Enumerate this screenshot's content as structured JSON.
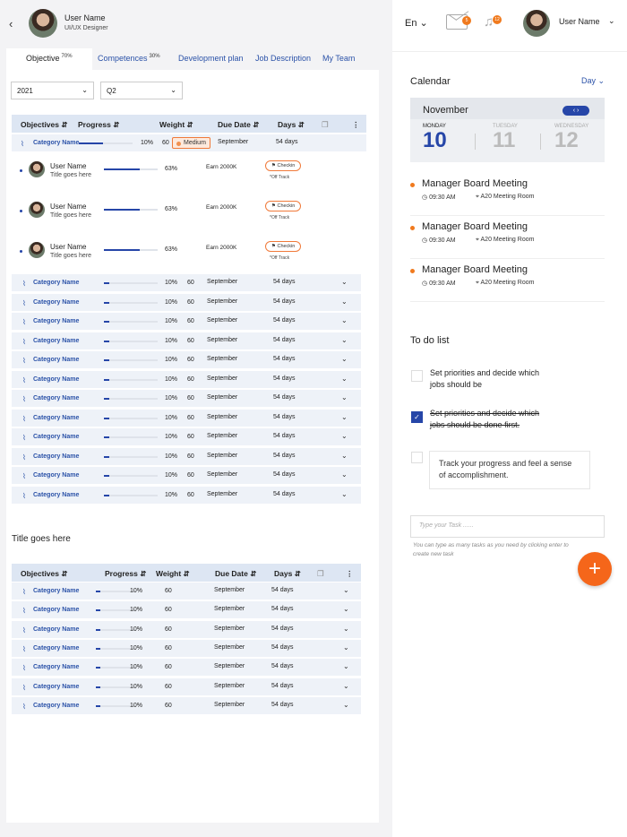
{
  "header": {
    "user_name": "User Name",
    "user_role": "UI/UX Designer"
  },
  "tabs": [
    {
      "label": "Objective",
      "sup": "70%"
    },
    {
      "label": "Competences",
      "sup": "30%"
    },
    {
      "label": "Development plan"
    },
    {
      "label": "Job Description"
    },
    {
      "label": "My Team"
    }
  ],
  "filters": {
    "year": "2021",
    "quarter": "Q2"
  },
  "table1": {
    "headers": {
      "objectives": "Objectives",
      "progress": "Progress",
      "weight": "Weight",
      "due": "Due Date",
      "days": "Days"
    },
    "category": {
      "name": "Category Name",
      "progress": 10,
      "progress_label": "10%",
      "weight": "60",
      "priority": "Medium",
      "due": "September",
      "days": "54 days"
    },
    "users": [
      {
        "name": "User Name",
        "title": "Title goes here",
        "progress": 63,
        "progress_label": "63%",
        "earn": "Earn 2000K",
        "checkin": "Checkin",
        "status": "*Off Track"
      },
      {
        "name": "User Name",
        "title": "Title goes here",
        "progress": 63,
        "progress_label": "63%",
        "earn": "Earn 2000K",
        "checkin": "Checkin",
        "status": "*Off Track"
      },
      {
        "name": "User Name",
        "title": "Title goes here",
        "progress": 63,
        "progress_label": "63%",
        "earn": "Earn 2000K",
        "checkin": "Checkin",
        "status": "*Off Track"
      }
    ],
    "rows": [
      {
        "name": "Category Name",
        "progress": 10,
        "progress_label": "10%",
        "weight": "60",
        "due": "September",
        "days": "54 days"
      },
      {
        "name": "Category Name",
        "progress": 10,
        "progress_label": "10%",
        "weight": "60",
        "due": "September",
        "days": "54 days"
      },
      {
        "name": "Category Name",
        "progress": 10,
        "progress_label": "10%",
        "weight": "60",
        "due": "September",
        "days": "54 days"
      },
      {
        "name": "Category Name",
        "progress": 10,
        "progress_label": "10%",
        "weight": "60",
        "due": "September",
        "days": "54 days"
      },
      {
        "name": "Category Name",
        "progress": 10,
        "progress_label": "10%",
        "weight": "60",
        "due": "September",
        "days": "54 days"
      },
      {
        "name": "Category Name",
        "progress": 10,
        "progress_label": "10%",
        "weight": "60",
        "due": "September",
        "days": "54 days"
      },
      {
        "name": "Category Name",
        "progress": 10,
        "progress_label": "10%",
        "weight": "60",
        "due": "September",
        "days": "54 days"
      },
      {
        "name": "Category Name",
        "progress": 10,
        "progress_label": "10%",
        "weight": "60",
        "due": "September",
        "days": "54 days"
      },
      {
        "name": "Category Name",
        "progress": 10,
        "progress_label": "10%",
        "weight": "60",
        "due": "September",
        "days": "54 days"
      },
      {
        "name": "Category Name",
        "progress": 10,
        "progress_label": "10%",
        "weight": "60",
        "due": "September",
        "days": "54 days"
      },
      {
        "name": "Category Name",
        "progress": 10,
        "progress_label": "10%",
        "weight": "60",
        "due": "September",
        "days": "54 days"
      },
      {
        "name": "Category Name",
        "progress": 10,
        "progress_label": "10%",
        "weight": "60",
        "due": "September",
        "days": "54 days"
      }
    ]
  },
  "section2_title": "Title goes here",
  "table2": {
    "headers": {
      "objectives": "Objectives",
      "progress": "Progress",
      "weight": "Weight",
      "due": "Due Date",
      "days": "Days"
    },
    "rows": [
      {
        "name": "Category Name",
        "progress": 10,
        "progress_label": "10%",
        "weight": "60",
        "due": "September",
        "days": "54 days"
      },
      {
        "name": "Category Name",
        "progress": 10,
        "progress_label": "10%",
        "weight": "60",
        "due": "September",
        "days": "54 days"
      },
      {
        "name": "Category Name",
        "progress": 10,
        "progress_label": "10%",
        "weight": "60",
        "due": "September",
        "days": "54 days"
      },
      {
        "name": "Category Name",
        "progress": 10,
        "progress_label": "10%",
        "weight": "60",
        "due": "September",
        "days": "54 days"
      },
      {
        "name": "Category Name",
        "progress": 10,
        "progress_label": "10%",
        "weight": "60",
        "due": "September",
        "days": "54 days"
      },
      {
        "name": "Category Name",
        "progress": 10,
        "progress_label": "10%",
        "weight": "60",
        "due": "September",
        "days": "54 days"
      },
      {
        "name": "Category Name",
        "progress": 10,
        "progress_label": "10%",
        "weight": "60",
        "due": "September",
        "days": "54 days"
      }
    ]
  },
  "topnav": {
    "language": "En",
    "mail_count": "5",
    "bell_count": "12",
    "user_name": "User Name"
  },
  "calendar": {
    "title": "Calendar",
    "mode": "Day",
    "month": "November",
    "days": [
      {
        "name": "MONDAY",
        "date": "10",
        "active": true
      },
      {
        "name": "TUESDAY",
        "date": "11",
        "active": false
      },
      {
        "name": "WEDNESDAY",
        "date": "12",
        "active": false
      }
    ],
    "meetings": [
      {
        "title": "Manager Board Meeting",
        "time": "09:30 AM",
        "room": "A20 Meeting Room"
      },
      {
        "title": "Manager Board Meeting",
        "time": "09:30 AM",
        "room": "A20 Meeting Room"
      },
      {
        "title": "Manager Board Meeting",
        "time": "09:30 AM",
        "room": "A20 Meeting Room"
      }
    ]
  },
  "todo": {
    "title": "To do list",
    "items": [
      {
        "text": "Set priorities and decide which jobs should be",
        "done": false
      },
      {
        "text": "Set priorities and decide which jobs should be done first.",
        "done": true
      },
      {
        "text": "Track your progress and feel a sense of accomplishment.",
        "done": false
      }
    ],
    "placeholder": "Type your Task ......",
    "hint": "You can type as many tasks as you need by clicking enter to create new task"
  },
  "colors": {
    "accent": "#2646a8",
    "orange": "#f5661a",
    "row_bg": "#eef2f8",
    "header_bg": "#dde6f3"
  }
}
